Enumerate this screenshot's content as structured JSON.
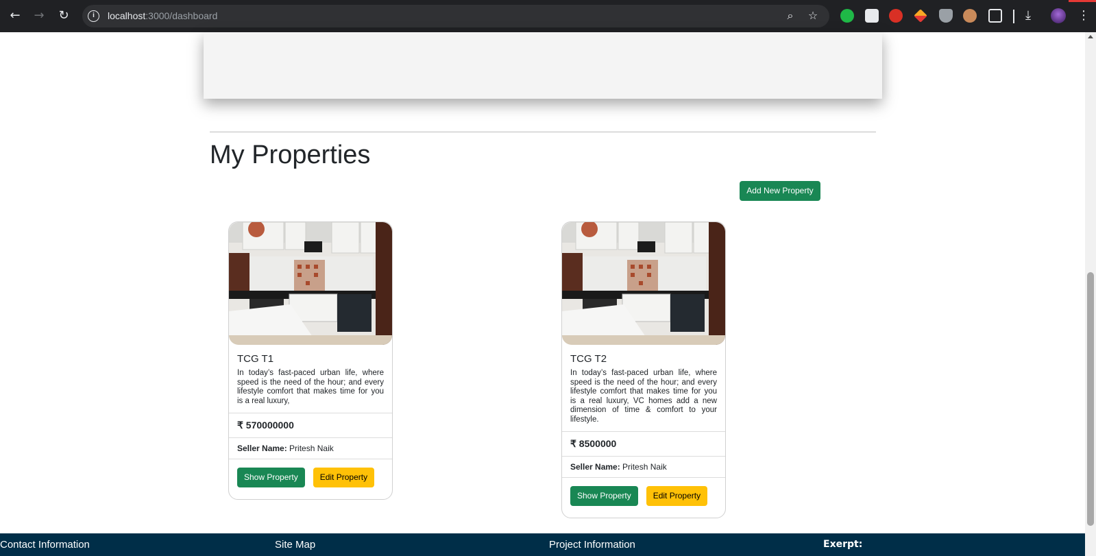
{
  "browser": {
    "url_host": "localhost",
    "url_rest": ":3000/dashboard"
  },
  "section": {
    "title": "My Properties",
    "add_button": "Add New Property"
  },
  "properties": [
    {
      "title": "TCG T1",
      "description": "In today’s fast-paced urban life, where speed is the need of the hour; and every lifestyle comfort that makes time for you is a real luxury,",
      "price": "₹ 570000000",
      "seller_label": "Seller Name:",
      "seller_name": "Pritesh Naik",
      "show_button": "Show Property",
      "edit_button": "Edit Property"
    },
    {
      "title": "TCG T2",
      "description": "In today’s fast-paced urban life, where speed is the need of the hour; and every lifestyle comfort that makes time for you is a real luxury, VC homes add a new dimension of time & comfort to your lifestyle.",
      "price": "₹ 8500000",
      "seller_label": "Seller Name:",
      "seller_name": "Pritesh Naik",
      "show_button": "Show Property",
      "edit_button": "Edit Property"
    }
  ],
  "footer": {
    "contact": "Contact Information",
    "sitemap": "Site Map",
    "project": "Project Information",
    "excerpt": "Exerpt:"
  },
  "colors": {
    "primary_green": "#198754",
    "warning_yellow": "#ffc107",
    "footer_bg": "#002e48"
  }
}
